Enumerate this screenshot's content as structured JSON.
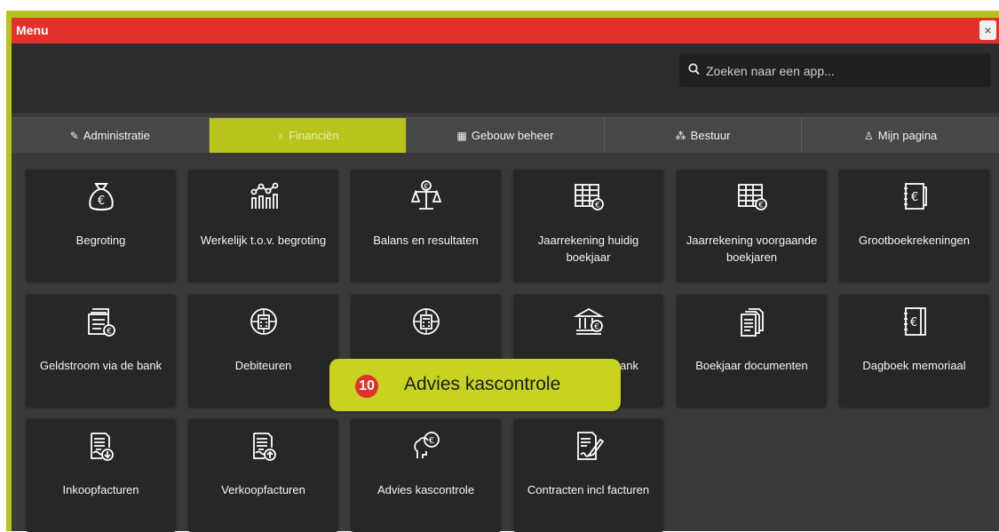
{
  "window": {
    "title": "Menu",
    "close_label": "×"
  },
  "search": {
    "placeholder": "Zoeken naar een app..."
  },
  "tabs": [
    {
      "label": "Administratie",
      "icon": "edit-icon",
      "active": false
    },
    {
      "label": "Financiën",
      "icon": "money-bag-icon",
      "active": true
    },
    {
      "label": "Gebouw beheer",
      "icon": "building-icon",
      "active": false
    },
    {
      "label": "Bestuur",
      "icon": "people-icon",
      "active": false
    },
    {
      "label": "Mijn pagina",
      "icon": "user-icon",
      "active": false
    }
  ],
  "tiles": [
    {
      "label": "Begroting",
      "icon": "money-bag-euro-icon"
    },
    {
      "label": "Werkelijk t.o.v. begroting",
      "icon": "bar-chart-network-icon"
    },
    {
      "label": "Balans en resultaten",
      "icon": "scale-euro-icon"
    },
    {
      "label": "Jaarrekening huidig boekjaar",
      "icon": "spreadsheet-euro-icon"
    },
    {
      "label": "Jaarrekening voorgaande boekjaren",
      "icon": "spreadsheet-euro-icon"
    },
    {
      "label": "Grootboekrekeningen",
      "icon": "ledger-euro-icon"
    },
    {
      "label": "Geldstroom via de bank",
      "icon": "document-stack-euro-icon"
    },
    {
      "label": "Debiteuren",
      "icon": "calculator-circle-icon"
    },
    {
      "label": "",
      "icon": "calculator-circle-icon"
    },
    {
      "label": "ank",
      "icon": "bank-euro-icon"
    },
    {
      "label": "Boekjaar documenten",
      "icon": "documents-icon"
    },
    {
      "label": "Dagboek memoriaal",
      "icon": "ledger-euro-icon"
    },
    {
      "label": "Inkoopfacturen",
      "icon": "invoice-download-icon"
    },
    {
      "label": "Verkoopfacturen",
      "icon": "invoice-upload-icon"
    },
    {
      "label": "Advies kascontrole",
      "icon": "advice-euro-icon"
    },
    {
      "label": "Contracten incl facturen",
      "icon": "contract-sign-icon"
    }
  ],
  "callout": {
    "number": "10",
    "text": "Advies kascontrole"
  },
  "colors": {
    "accent": "#b8c41c",
    "titlebar": "#e3302a",
    "tile": "#272727",
    "background": "#3a3a3a"
  }
}
